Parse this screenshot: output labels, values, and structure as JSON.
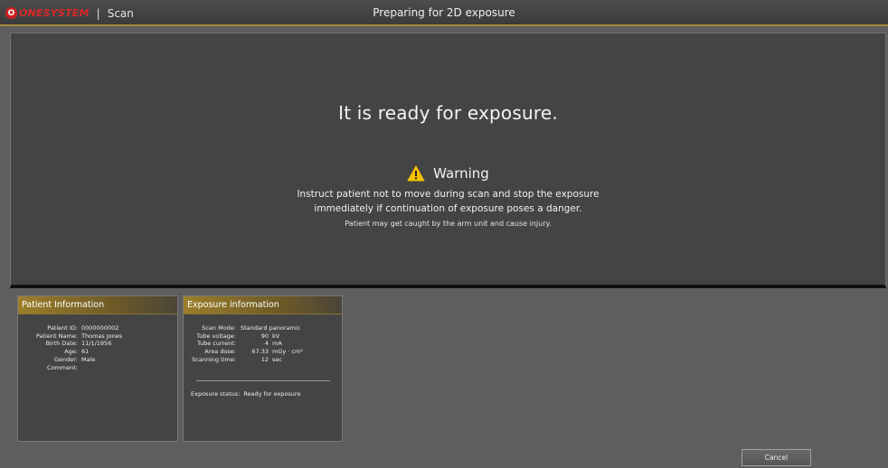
{
  "titlebar": {
    "brand_logo": "O",
    "brand_name": "ONESYSTEM",
    "separator": "|",
    "app_section": "Scan",
    "title": "Preparing for 2D exposure"
  },
  "main": {
    "ready_text": "It is ready for exposure.",
    "warning_icon": "warning-triangle",
    "warning_title": "Warning",
    "warning_line1": "Instruct patient not to move during scan and stop the exposure",
    "warning_line2": "immediately if continuation of exposure poses a danger.",
    "warning_line3": "Patient may get caught by the arm unit and cause injury."
  },
  "patient": {
    "header": "Patient Information",
    "rows": [
      {
        "label": "Patient ID:",
        "value": "0000000002"
      },
      {
        "label": "Patient Name:",
        "value": "Thomas Jones"
      },
      {
        "label": "Birth Date:",
        "value": "11/1/1956"
      },
      {
        "label": "Age:",
        "value": "61"
      },
      {
        "label": "Gender:",
        "value": "Male"
      },
      {
        "label": "Comment:",
        "value": ""
      }
    ]
  },
  "exposure": {
    "header": "Exposure information",
    "scan_mode_label": "Scan Mode:",
    "scan_mode_value": "Standard panoramic",
    "rows": [
      {
        "label": "Tube voltage:",
        "value": "90",
        "unit": "kV"
      },
      {
        "label": "Tube current:",
        "value": "4",
        "unit": "mA"
      },
      {
        "label": "Area dose:",
        "value": "67.33",
        "unit": "mGy · cm²"
      },
      {
        "label": "Scanning time:",
        "value": "12",
        "unit": "sec"
      }
    ],
    "status_label": "Exposure status:",
    "status_value": "Ready for exposure"
  },
  "buttons": {
    "cancel": "Cancel"
  },
  "colors": {
    "accent_gold": "#a88a3a",
    "brand_red": "#d8282a",
    "warning_yellow": "#f5c000"
  }
}
